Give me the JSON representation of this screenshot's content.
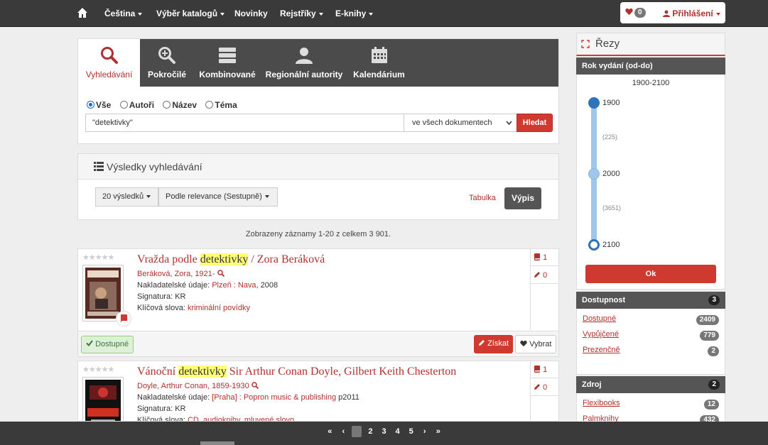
{
  "nav": {
    "items": [
      "Čeština",
      "Výběr katalogů",
      "Novinky",
      "Rejstříky",
      "E-knihy"
    ],
    "cart_count": "0",
    "login_label": "Přihlášení"
  },
  "search": {
    "tabs": [
      "Vyhledávání",
      "Pokročilé",
      "Kombinované",
      "Regionální autority",
      "Kalendárium"
    ],
    "radios": [
      "Vše",
      "Autoři",
      "Název",
      "Téma"
    ],
    "query": "\"detektivky\"",
    "scope": "ve všech dokumentech",
    "submit_label": "Hledat"
  },
  "results": {
    "title": "Výsledky vyhledávání",
    "per_page": "20 výsledků",
    "sort": "Podle relevance (Sestupně)",
    "view_table": "Tabulka",
    "view_list": "Výpis",
    "summary": "Zobrazeny záznamy 1-20 z celkem 3 901."
  },
  "records": [
    {
      "title_pre": "Vražda podle ",
      "title_hl": "detektivky",
      "title_post": " / Zora Beráková",
      "author": "Beráková, Zora, 1921-",
      "publisher_label": "Nakladatelské údaje:",
      "publisher_link": "Plzeň : Nava",
      "publisher_rest": ", 2008",
      "signature_label": "Signatura:",
      "signature": "KR",
      "keywords_label": "Klíčová slova:",
      "keywords": "kriminální povídky",
      "count_items": "1",
      "count_reviews": "0",
      "availability": "Dostupné",
      "get_label": "Získat",
      "pick_label": "Vybrat"
    },
    {
      "title_pre": "Vánoční ",
      "title_hl": "detektivky",
      "title_post": " Sir Arthur Conan Doyle, Gilbert Keith Chesterton",
      "author": "Doyle, Arthur Conan, 1859-1930",
      "publisher_label": "Nakladatelské údaje:",
      "publisher_link": "[Praha] : Popron music & publishing",
      "publisher_rest": " p2011",
      "signature_label": "Signatura:",
      "signature": "KR",
      "keywords_label": "Klíčová slova:",
      "keywords": "CD, audioknihy, mluvené slovo",
      "count_items": "1",
      "count_reviews": "0"
    }
  ],
  "facets": {
    "title": "Řezy",
    "year": {
      "title": "Rok vydání (od-do)",
      "range": "1900-2100",
      "from": "1900",
      "mid": "2000",
      "to": "2100",
      "count_low": "(225)",
      "count_high": "(3651)",
      "ok_label": "Ok"
    },
    "availability": {
      "title": "Dostupnost",
      "count": "3",
      "items": [
        {
          "label": "Dostupné",
          "count": "2409"
        },
        {
          "label": "Vypůjčené",
          "count": "779"
        },
        {
          "label": "Prezenčně",
          "count": "2"
        }
      ]
    },
    "source": {
      "title": "Zdroj",
      "count": "2",
      "items": [
        {
          "label": "Flexibooks",
          "count": "12"
        },
        {
          "label": "Palmknihy",
          "count": "432"
        }
      ]
    }
  },
  "pager": {
    "first": "«",
    "prev": "‹",
    "current": "1",
    "pages": [
      "2",
      "3",
      "4",
      "5"
    ],
    "next": "›",
    "last": "»"
  },
  "colors": {
    "accent": "#d0392f",
    "link": "#b0312d",
    "navbar": "#3a3a3a",
    "highlight": "#ffff77"
  }
}
